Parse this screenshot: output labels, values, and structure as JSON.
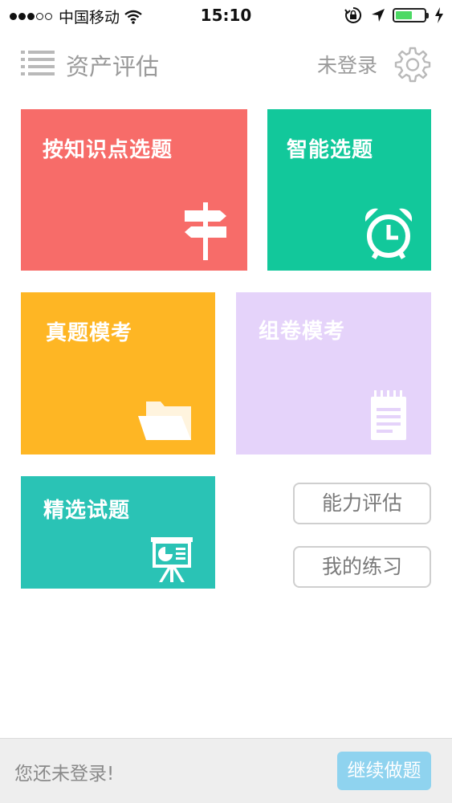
{
  "status_bar": {
    "carrier": "中国移动",
    "time": "15:10",
    "battery_level": 0.6,
    "battery_color": "#4cd964"
  },
  "header": {
    "menu_icon": "list-menu-icon",
    "title": "资产评估",
    "login_status": "未登录",
    "settings_icon": "gear-icon"
  },
  "tiles": [
    {
      "label": "按知识点选题",
      "color": "#f76c69",
      "icon": "signpost-icon"
    },
    {
      "label": "智能选题",
      "color": "#12c89b",
      "icon": "alarm-clock-icon"
    },
    {
      "label": "真题模考",
      "color": "#feb624",
      "icon": "folder-icon"
    },
    {
      "label": "组卷模考",
      "color": "#e5d3fa",
      "icon": "notepad-icon"
    },
    {
      "label": "精选试题",
      "color": "#2ac3b5",
      "icon": "presentation-board-icon"
    }
  ],
  "buttons": {
    "ability_assessment": "能力评估",
    "my_practice": "我的练习"
  },
  "bottom_bar": {
    "message": "您还未登录!",
    "continue_label": "继续做题",
    "continue_color": "#8fd3ef"
  }
}
